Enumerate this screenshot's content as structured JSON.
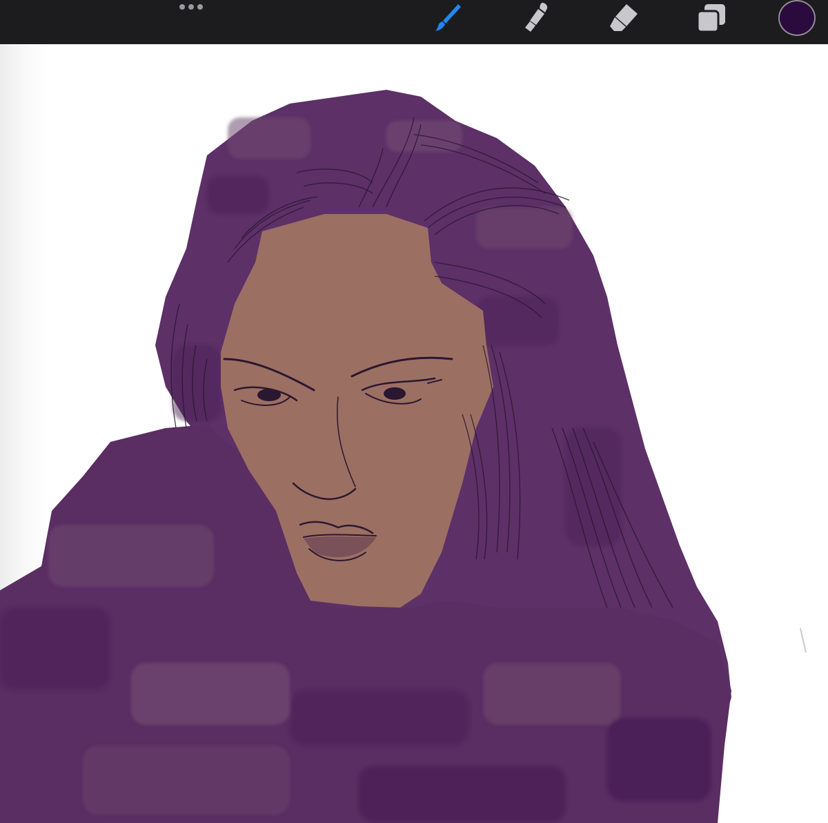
{
  "toolbar": {
    "more_icon": "more-dots-icon",
    "tools": [
      {
        "name": "paint-brush-icon",
        "active": true,
        "color": "#1e88f5"
      },
      {
        "name": "smudge-icon",
        "active": false,
        "color": "#c7c7cc"
      },
      {
        "name": "eraser-icon",
        "active": false,
        "color": "#c7c7cc"
      },
      {
        "name": "layers-icon",
        "active": false,
        "color": "#c7c7cc"
      }
    ],
    "current_color": "#2b0b3d"
  },
  "canvas": {
    "background_color": "#ffffff",
    "artwork_colors": {
      "hair_and_collar": "#5a2f66",
      "skin": "#9b6d62",
      "line_art": "#2a1730"
    }
  }
}
